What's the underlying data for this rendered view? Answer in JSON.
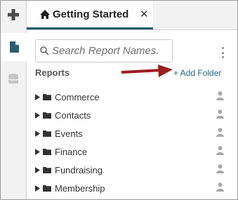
{
  "rail": {
    "items": [
      {
        "icon": "plus-icon"
      },
      {
        "icon": "document-icon",
        "active": true
      },
      {
        "icon": "database-icon"
      }
    ]
  },
  "tab": {
    "icon": "home-icon",
    "title": "Getting Started",
    "close_glyph": "✕"
  },
  "search": {
    "placeholder": "Search Report Names.",
    "value": ""
  },
  "reports": {
    "heading": "Reports",
    "add_folder_label": "+ Add Folder",
    "folders": [
      {
        "label": "Commerce"
      },
      {
        "label": "Contacts"
      },
      {
        "label": "Events"
      },
      {
        "label": "Finance"
      },
      {
        "label": "Fundraising"
      },
      {
        "label": "Membership"
      }
    ]
  },
  "colors": {
    "accent": "#1d5a70",
    "annotation_arrow": "#9b1c22",
    "link": "#1d6a80"
  }
}
